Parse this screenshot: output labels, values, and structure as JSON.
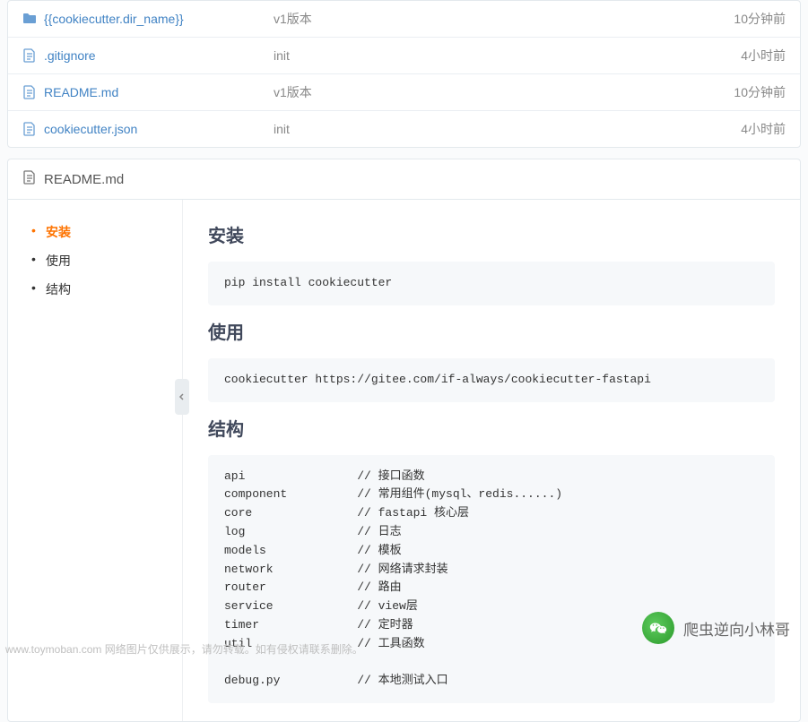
{
  "files": [
    {
      "icon": "folder",
      "name": "{{cookiecutter.dir_name}}",
      "commit": "v1版本",
      "time": "10分钟前"
    },
    {
      "icon": "file",
      "name": ".gitignore",
      "commit": "init",
      "time": "4小时前"
    },
    {
      "icon": "file",
      "name": "README.md",
      "commit": "v1版本",
      "time": "10分钟前"
    },
    {
      "icon": "file",
      "name": "cookiecutter.json",
      "commit": "init",
      "time": "4小时前"
    }
  ],
  "readme": {
    "title": "README.md",
    "toc": [
      {
        "label": "安装",
        "active": true
      },
      {
        "label": "使用",
        "active": false
      },
      {
        "label": "结构",
        "active": false
      }
    ],
    "sections": {
      "install": {
        "heading": "安装",
        "code": "pip install cookiecutter"
      },
      "usage": {
        "heading": "使用",
        "code": "cookiecutter https://gitee.com/if-always/cookiecutter-fastapi"
      },
      "structure": {
        "heading": "结构",
        "code": "api                // 接口函数\ncomponent          // 常用组件(mysql、redis......)\ncore               // fastapi 核心层\nlog                // 日志\nmodels             // 模板\nnetwork            // 网络请求封装\nrouter             // 路由\nservice            // view层\ntimer              // 定时器\nutil               // 工具函数\n\ndebug.py           // 本地测试入口"
      }
    }
  },
  "watermark": {
    "left": "www.toymoban.com 网络图片仅供展示，请勿转载。如有侵权请联系删除。",
    "right": "爬虫逆向小林哥"
  }
}
